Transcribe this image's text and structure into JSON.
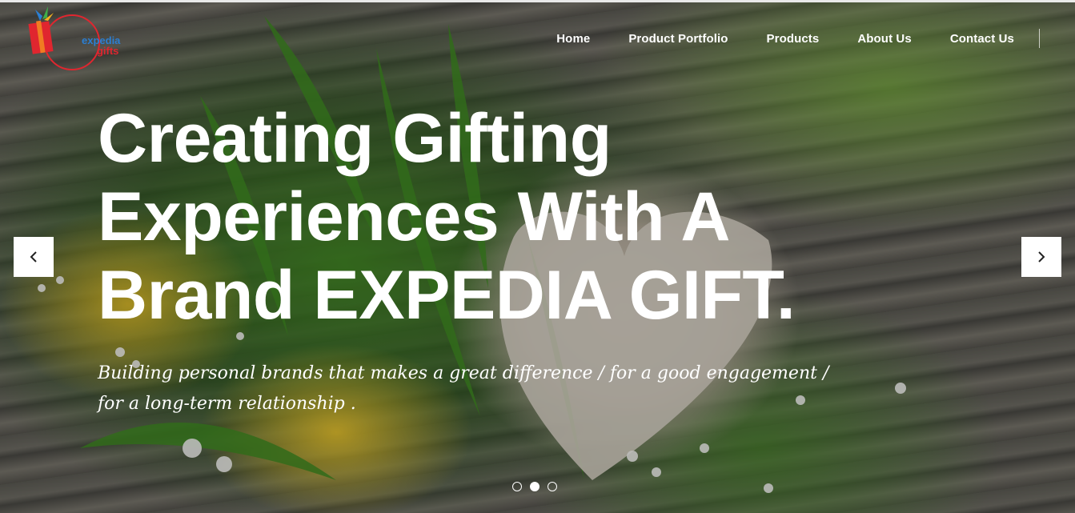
{
  "brand": {
    "logo_line1": "expedia",
    "logo_line2": "gifts"
  },
  "nav": {
    "items": [
      {
        "label": "Home"
      },
      {
        "label": "Product Portfolio"
      },
      {
        "label": "Products"
      },
      {
        "label": "About Us"
      },
      {
        "label": "Contact Us"
      }
    ]
  },
  "hero": {
    "headline_lines": [
      "Creating Gifting",
      "Experiences With A",
      "Brand EXPEDIA GIFT."
    ],
    "tagline_lines": [
      "Building personal brands that makes a great difference / for a good engagement /",
      "for a long-term relationship ."
    ]
  },
  "carousel": {
    "slide_count": 3,
    "active_index": 1
  },
  "colors": {
    "logo_blue": "#2b7fd3",
    "logo_red": "#e0262f",
    "text": "#ffffff"
  },
  "icons": {
    "prev": "chevron-left-icon",
    "next": "chevron-right-icon"
  }
}
